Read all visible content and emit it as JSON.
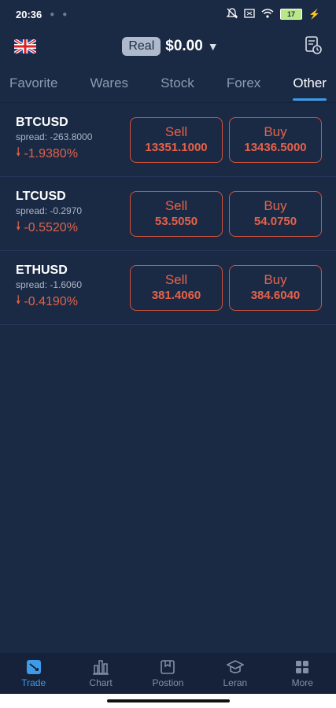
{
  "status_bar": {
    "time": "20:36",
    "battery": "17"
  },
  "header": {
    "account_type": "Real",
    "balance": "$0.00"
  },
  "tabs": [
    {
      "label": "Favorite",
      "active": false
    },
    {
      "label": "Wares",
      "active": false
    },
    {
      "label": "Stock",
      "active": false
    },
    {
      "label": "Forex",
      "active": false
    },
    {
      "label": "Other",
      "active": true
    }
  ],
  "instruments": [
    {
      "symbol": "BTCUSD",
      "spread": "spread:  -263.8000",
      "change": "-1.9380%",
      "sell_label": "Sell",
      "sell_price": "13351.1000",
      "buy_label": "Buy",
      "buy_price": "13436.5000"
    },
    {
      "symbol": "LTCUSD",
      "spread": "spread:  -0.2970",
      "change": "-0.5520%",
      "sell_label": "Sell",
      "sell_price": "53.5050",
      "buy_label": "Buy",
      "buy_price": "54.0750"
    },
    {
      "symbol": "ETHUSD",
      "spread": "spread:  -1.6060",
      "change": "-0.4190%",
      "sell_label": "Sell",
      "sell_price": "381.4060",
      "buy_label": "Buy",
      "buy_price": "384.6040"
    }
  ],
  "nav": [
    {
      "label": "Trade",
      "icon": "trade-icon",
      "active": true
    },
    {
      "label": "Chart",
      "icon": "chart-icon",
      "active": false
    },
    {
      "label": "Postion",
      "icon": "position-icon",
      "active": false
    },
    {
      "label": "Leran",
      "icon": "learn-icon",
      "active": false
    },
    {
      "label": "More",
      "icon": "more-icon",
      "active": false
    }
  ],
  "colors": {
    "background": "#1b2a44",
    "accent": "#3d9be9",
    "negative": "#e0624b"
  }
}
